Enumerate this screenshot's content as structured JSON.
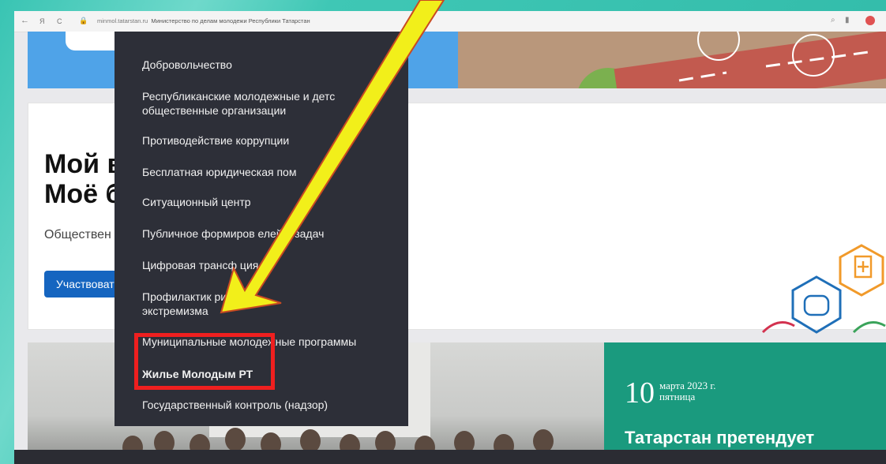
{
  "browser": {
    "back": "←",
    "yandex": "Я",
    "reload": "C",
    "domain": "minmol.tatarstan.ru",
    "page_title": "Министерство по делам молодежи Республики Татарстан"
  },
  "menu": {
    "items": [
      "Добровольчество",
      "Республиканские молодежные и детс",
      "общественные организации",
      "Противодействие коррупции",
      "Бесплатная юридическая пом",
      "Ситуационный центр",
      "Публичное формиров     елей и задач",
      "Цифровая трансф      ция",
      "Профилактик      ризма и",
      "экстремизма",
      "Муниципальные молодежные программы",
      "Жилье Молодым РТ",
      "Государственный контроль (надзор)"
    ]
  },
  "card": {
    "title": "Мой в\nМоё б",
    "subtitle": "Обществен",
    "button": "Участвоват"
  },
  "news": {
    "day": "10",
    "month": "марта 2023 г.",
    "weekday": "пятница",
    "headline": "Татарстан претендует"
  },
  "colors": {
    "menu_bg": "#2d2f38",
    "highlight": "#ef1f1f",
    "arrow": "#f2ef1a",
    "accent_green": "#1a9a7e",
    "button_blue": "#1565c0"
  }
}
